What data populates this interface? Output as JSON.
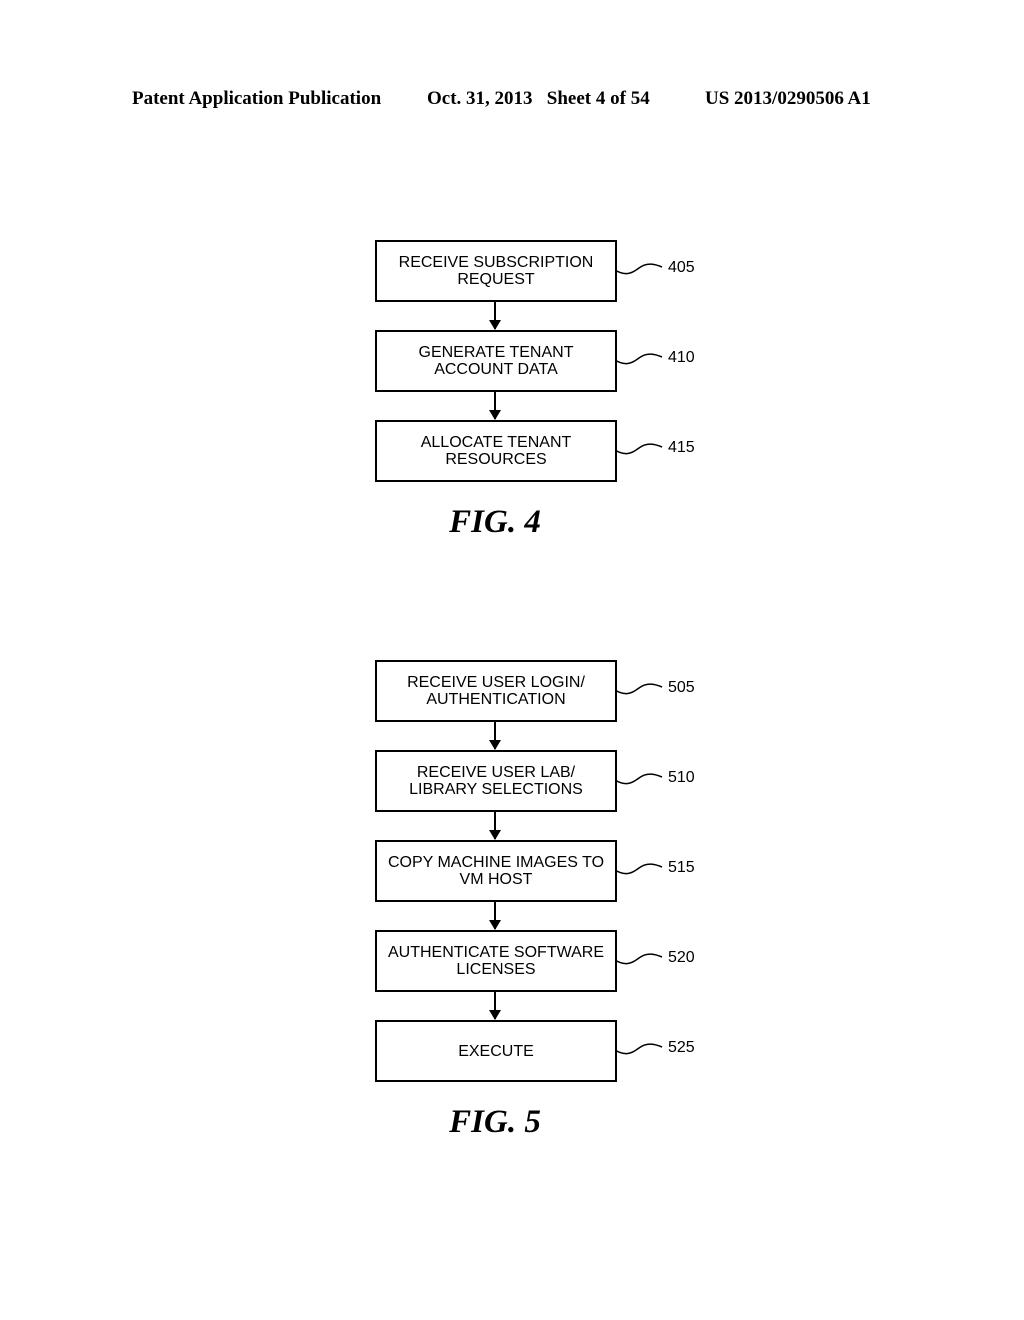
{
  "header": {
    "left": "Patent Application Publication",
    "middle": "Oct. 31, 2013   Sheet 4 of 54",
    "right": "US 2013/0290506 A1"
  },
  "figures": [
    {
      "caption": "FIG. 4",
      "steps": [
        {
          "label": "RECEIVE SUBSCRIPTION\nREQUEST",
          "ref": "405"
        },
        {
          "label": "GENERATE TENANT\nACCOUNT DATA",
          "ref": "410"
        },
        {
          "label": "ALLOCATE TENANT\nRESOURCES",
          "ref": "415"
        }
      ]
    },
    {
      "caption": "FIG. 5",
      "steps": [
        {
          "label": "RECEIVE USER LOGIN/\nAUTHENTICATION",
          "ref": "505"
        },
        {
          "label": "RECEIVE USER LAB/\nLIBRARY SELECTIONS",
          "ref": "510"
        },
        {
          "label": "COPY MACHINE IMAGES TO\nVM HOST",
          "ref": "515"
        },
        {
          "label": "AUTHENTICATE SOFTWARE\nLICENSES",
          "ref": "520"
        },
        {
          "label": "EXECUTE",
          "ref": "525"
        }
      ]
    }
  ]
}
